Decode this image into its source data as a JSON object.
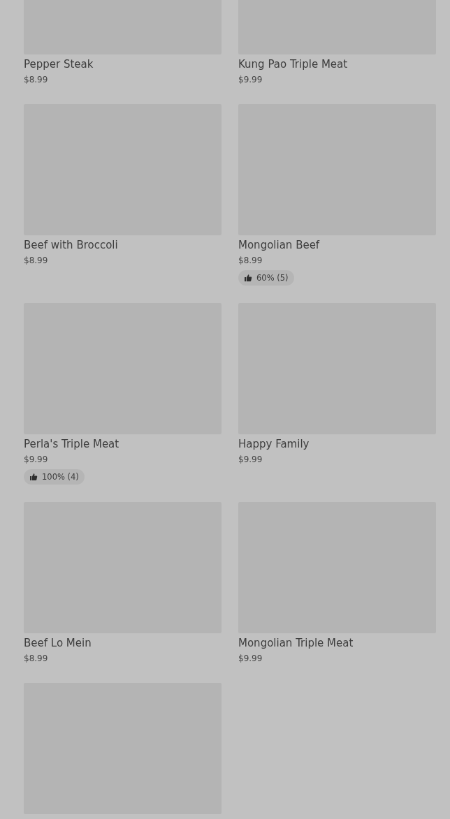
{
  "items": [
    {
      "kind": "dish",
      "name": "Pepper Steak",
      "price": "$8.99"
    },
    {
      "kind": "dish",
      "name": "Kung Pao Triple Meat",
      "price": "$9.99"
    },
    {
      "kind": "dish",
      "name": "Beef with Broccoli",
      "price": "$8.99"
    },
    {
      "kind": "dish",
      "name": "Mongolian Beef",
      "price": "$8.99",
      "rating": "60% (5)"
    },
    {
      "kind": "dish",
      "name": "Perla's Triple Meat",
      "price": "$9.99",
      "rating": "100% (4)"
    },
    {
      "kind": "dish",
      "name": "Happy Family",
      "price": "$9.99"
    },
    {
      "kind": "dish",
      "name": "Beef Lo Mein",
      "price": "$8.99"
    },
    {
      "kind": "dish",
      "name": "Mongolian Triple Meat",
      "price": "$9.99"
    },
    {
      "kind": "image_only"
    }
  ]
}
